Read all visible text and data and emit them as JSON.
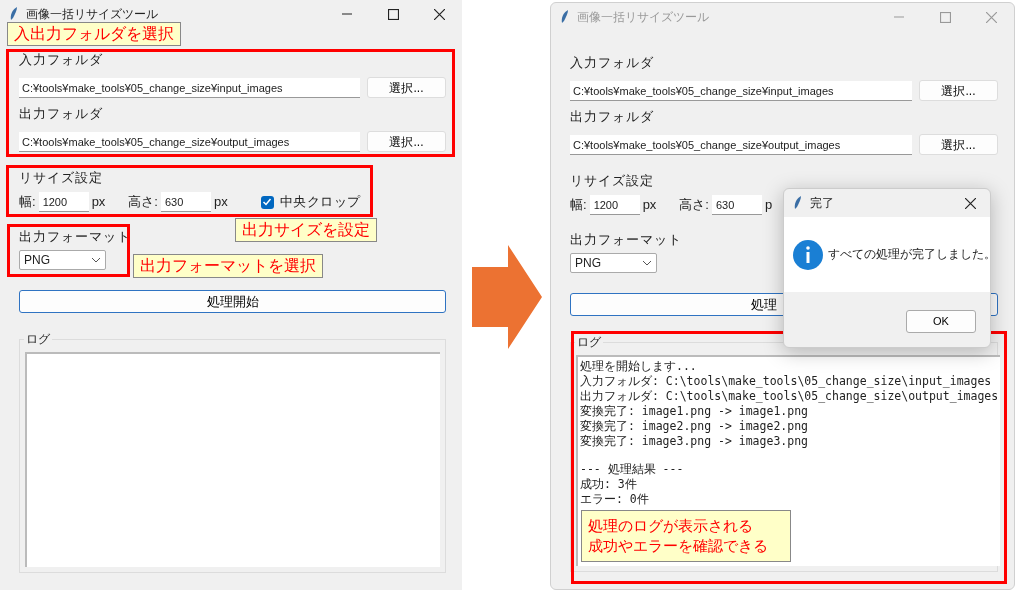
{
  "windows": [
    {
      "title": "画像一括リサイズツール",
      "active": true,
      "notes": [
        {
          "lines": [
            "入出力フォルダを選択"
          ]
        },
        {
          "lines": [
            "出力サイズを設定"
          ]
        },
        {
          "lines": [
            "出力フォーマットを選択"
          ]
        }
      ],
      "input_folder": {
        "label": "入力フォルダ",
        "value": "C:¥tools¥make_tools¥05_change_size¥input_images",
        "button": "選択..."
      },
      "output_folder": {
        "label": "出力フォルダ",
        "value": "C:¥tools¥make_tools¥05_change_size¥output_images",
        "button": "選択..."
      },
      "resize": {
        "heading": "リサイズ設定",
        "width_label": "幅:",
        "width_value": "1200",
        "width_unit": "px",
        "height_label": "高さ:",
        "height_value": "630",
        "height_unit": "px",
        "crop": {
          "label": "中央クロップ",
          "checked": true
        }
      },
      "format": {
        "label": "出力フォーマット",
        "value": "PNG"
      },
      "start_button": "処理開始",
      "log": {
        "legend": "ログ"
      }
    },
    {
      "title": "画像一括リサイズツール",
      "active": false,
      "notes": [
        {
          "lines": [
            "処理のログが表示される",
            "成功やエラーを確認できる"
          ]
        }
      ],
      "input_folder": {
        "label": "入力フォルダ",
        "value": "C:¥tools¥make_tools¥05_change_size¥input_images",
        "button": "選択..."
      },
      "output_folder": {
        "label": "出力フォルダ",
        "value": "C:¥tools¥make_tools¥05_change_size¥output_images",
        "button": "選択..."
      },
      "resize": {
        "heading": "リサイズ設定",
        "width_label": "幅:",
        "width_value": "1200",
        "width_unit": "px",
        "height_label": "高さ:",
        "height_value": "630",
        "height_unit": "p"
      },
      "format": {
        "label": "出力フォーマット",
        "value": "PNG"
      },
      "start_button": "処理",
      "log": {
        "legend": "ログ",
        "paragraphs": [
          [
            "処理を開始します...",
            "入力フォルダ: C:\\tools\\make_tools\\05_change_size\\input_images",
            "出力フォルダ: C:\\tools\\make_tools\\05_change_size\\output_images",
            "変換完了: image1.png -> image1.png",
            "変換完了: image2.png -> image2.png",
            "変換完了: image3.png -> image3.png"
          ],
          [
            "--- 処理結果 ---",
            "成功: 3件",
            "エラー: 0件"
          ]
        ]
      },
      "dialog": {
        "title": "完了",
        "message": "すべての処理が完了しました。",
        "ok": "OK"
      }
    }
  ]
}
